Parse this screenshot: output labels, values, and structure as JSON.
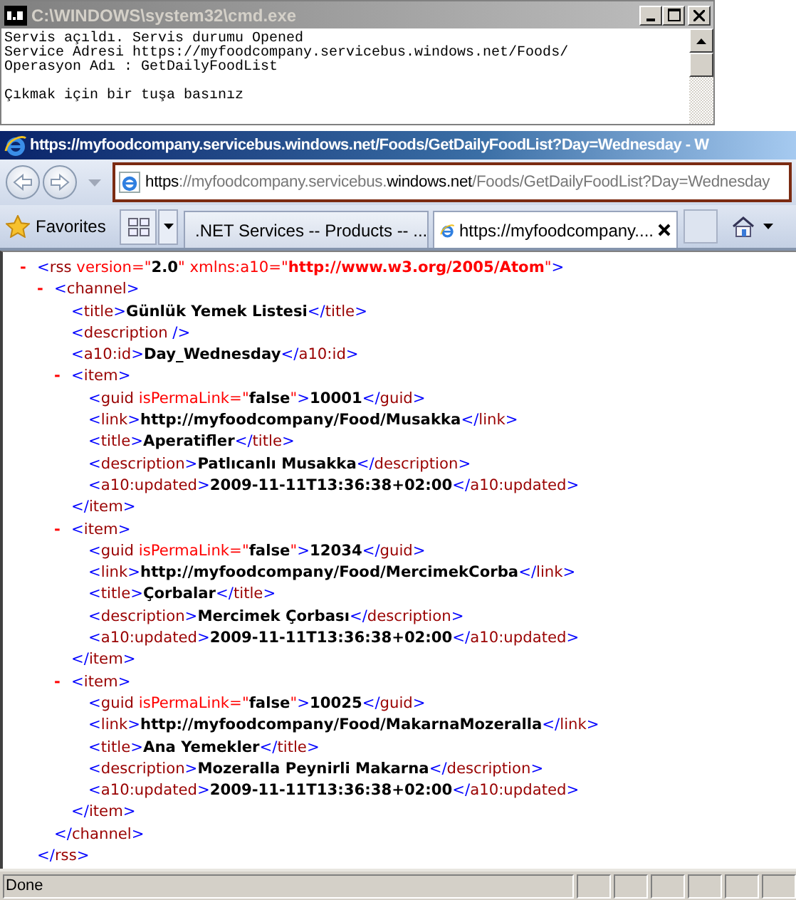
{
  "console": {
    "title": "C:\\WINDOWS\\system32\\cmd.exe",
    "output": [
      "Servis açıldı. Servis durumu Opened",
      "Service Adresi https://myfoodcompany.servicebus.windows.net/Foods/",
      "Operasyon Adı : GetDailyFoodList"
    ],
    "prompt": "Çıkmak için bir tuşa basınız"
  },
  "browser": {
    "title": "https://myfoodcompany.servicebus.windows.net/Foods/GetDailyFoodList?Day=Wednesday - W",
    "address": [
      {
        "text": "https",
        "highlighted": true
      },
      {
        "text": "://myfoodcompany.servicebus.",
        "highlighted": false
      },
      {
        "text": "windows.net",
        "highlighted": true
      },
      {
        "text": "/Foods/GetDailyFoodList?Day=Wednesday",
        "highlighted": false
      }
    ],
    "favorites": "Favorites",
    "tabs": [
      {
        "label": ".NET Services -- Products -- ...",
        "selected": false
      },
      {
        "label": "https://myfoodcompany....",
        "selected": true
      }
    ],
    "document": {
      "toggle": "-",
      "expanded": true,
      "open": "<rss",
      "attributes": [
        {
          "kind": "plain",
          "text": " version=\"2.0\""
        },
        {
          "kind": "namespace",
          "text": " xmlns:a10=\"http://www.w3.org/2005/Atom\""
        }
      ],
      "open_end": ">",
      "close": "</rss>",
      "children": [
        {
          "toggle": "-",
          "expanded": true,
          "open": "<channel>",
          "close": "</channel>",
          "children": [
            {
              "open": "<title>",
              "text": "Günlük Yemek Listesi",
              "close": "</title>"
            },
            {
              "open": "<description />"
            },
            {
              "open": "<a10:id>",
              "text": "Day_Wednesday",
              "close": "</a10:id>"
            },
            {
              "toggle": "-",
              "expanded": true,
              "open": "<item>",
              "close": "</item>",
              "children": [
                {
                  "open": "<guid",
                  "attributes": [
                    {
                      "kind": "plain",
                      "text": " isPermaLink=\"false\""
                    }
                  ],
                  "open_end": ">",
                  "text": "10001",
                  "close": "</guid>"
                },
                {
                  "open": "<link>",
                  "text": "http://myfoodcompany/Food/Musakka",
                  "close": "</link>"
                },
                {
                  "open": "<title>",
                  "text": "Aperatifler",
                  "close": "</title>"
                },
                {
                  "open": "<description>",
                  "text": "Patlıcanlı Musakka",
                  "close": "</description>"
                },
                {
                  "open": "<a10:updated>",
                  "text": "2009-11-11T13:36:38+02:00",
                  "close": "</a10:updated>"
                }
              ]
            },
            {
              "toggle": "-",
              "expanded": true,
              "open": "<item>",
              "close": "</item>",
              "children": [
                {
                  "open": "<guid",
                  "attributes": [
                    {
                      "kind": "plain",
                      "text": " isPermaLink=\"false\""
                    }
                  ],
                  "open_end": ">",
                  "text": "12034",
                  "close": "</guid>"
                },
                {
                  "open": "<link>",
                  "text": "http://myfoodcompany/Food/MercimekCorba",
                  "close": "</link>"
                },
                {
                  "open": "<title>",
                  "text": "Çorbalar",
                  "close": "</title>"
                },
                {
                  "open": "<description>",
                  "text": "Mercimek Çorbası",
                  "close": "</description>"
                },
                {
                  "open": "<a10:updated>",
                  "text": "2009-11-11T13:36:38+02:00",
                  "close": "</a10:updated>"
                }
              ]
            },
            {
              "toggle": "-",
              "expanded": true,
              "open": "<item>",
              "close": "</item>",
              "children": [
                {
                  "open": "<guid",
                  "attributes": [
                    {
                      "kind": "plain",
                      "text": " isPermaLink=\"false\""
                    }
                  ],
                  "open_end": ">",
                  "text": "10025",
                  "close": "</guid>"
                },
                {
                  "open": "<link>",
                  "text": "http://myfoodcompany/Food/MakarnaMozeralla",
                  "close": "</link>"
                },
                {
                  "open": "<title>",
                  "text": "Ana Yemekler",
                  "close": "</title>"
                },
                {
                  "open": "<description>",
                  "text": "Mozeralla Peynirli Makarna",
                  "close": "</description>"
                },
                {
                  "open": "<a10:updated>",
                  "text": "2009-11-11T13:36:38+02:00",
                  "close": "</a10:updated>"
                }
              ]
            }
          ]
        }
      ]
    },
    "status": "Done"
  }
}
